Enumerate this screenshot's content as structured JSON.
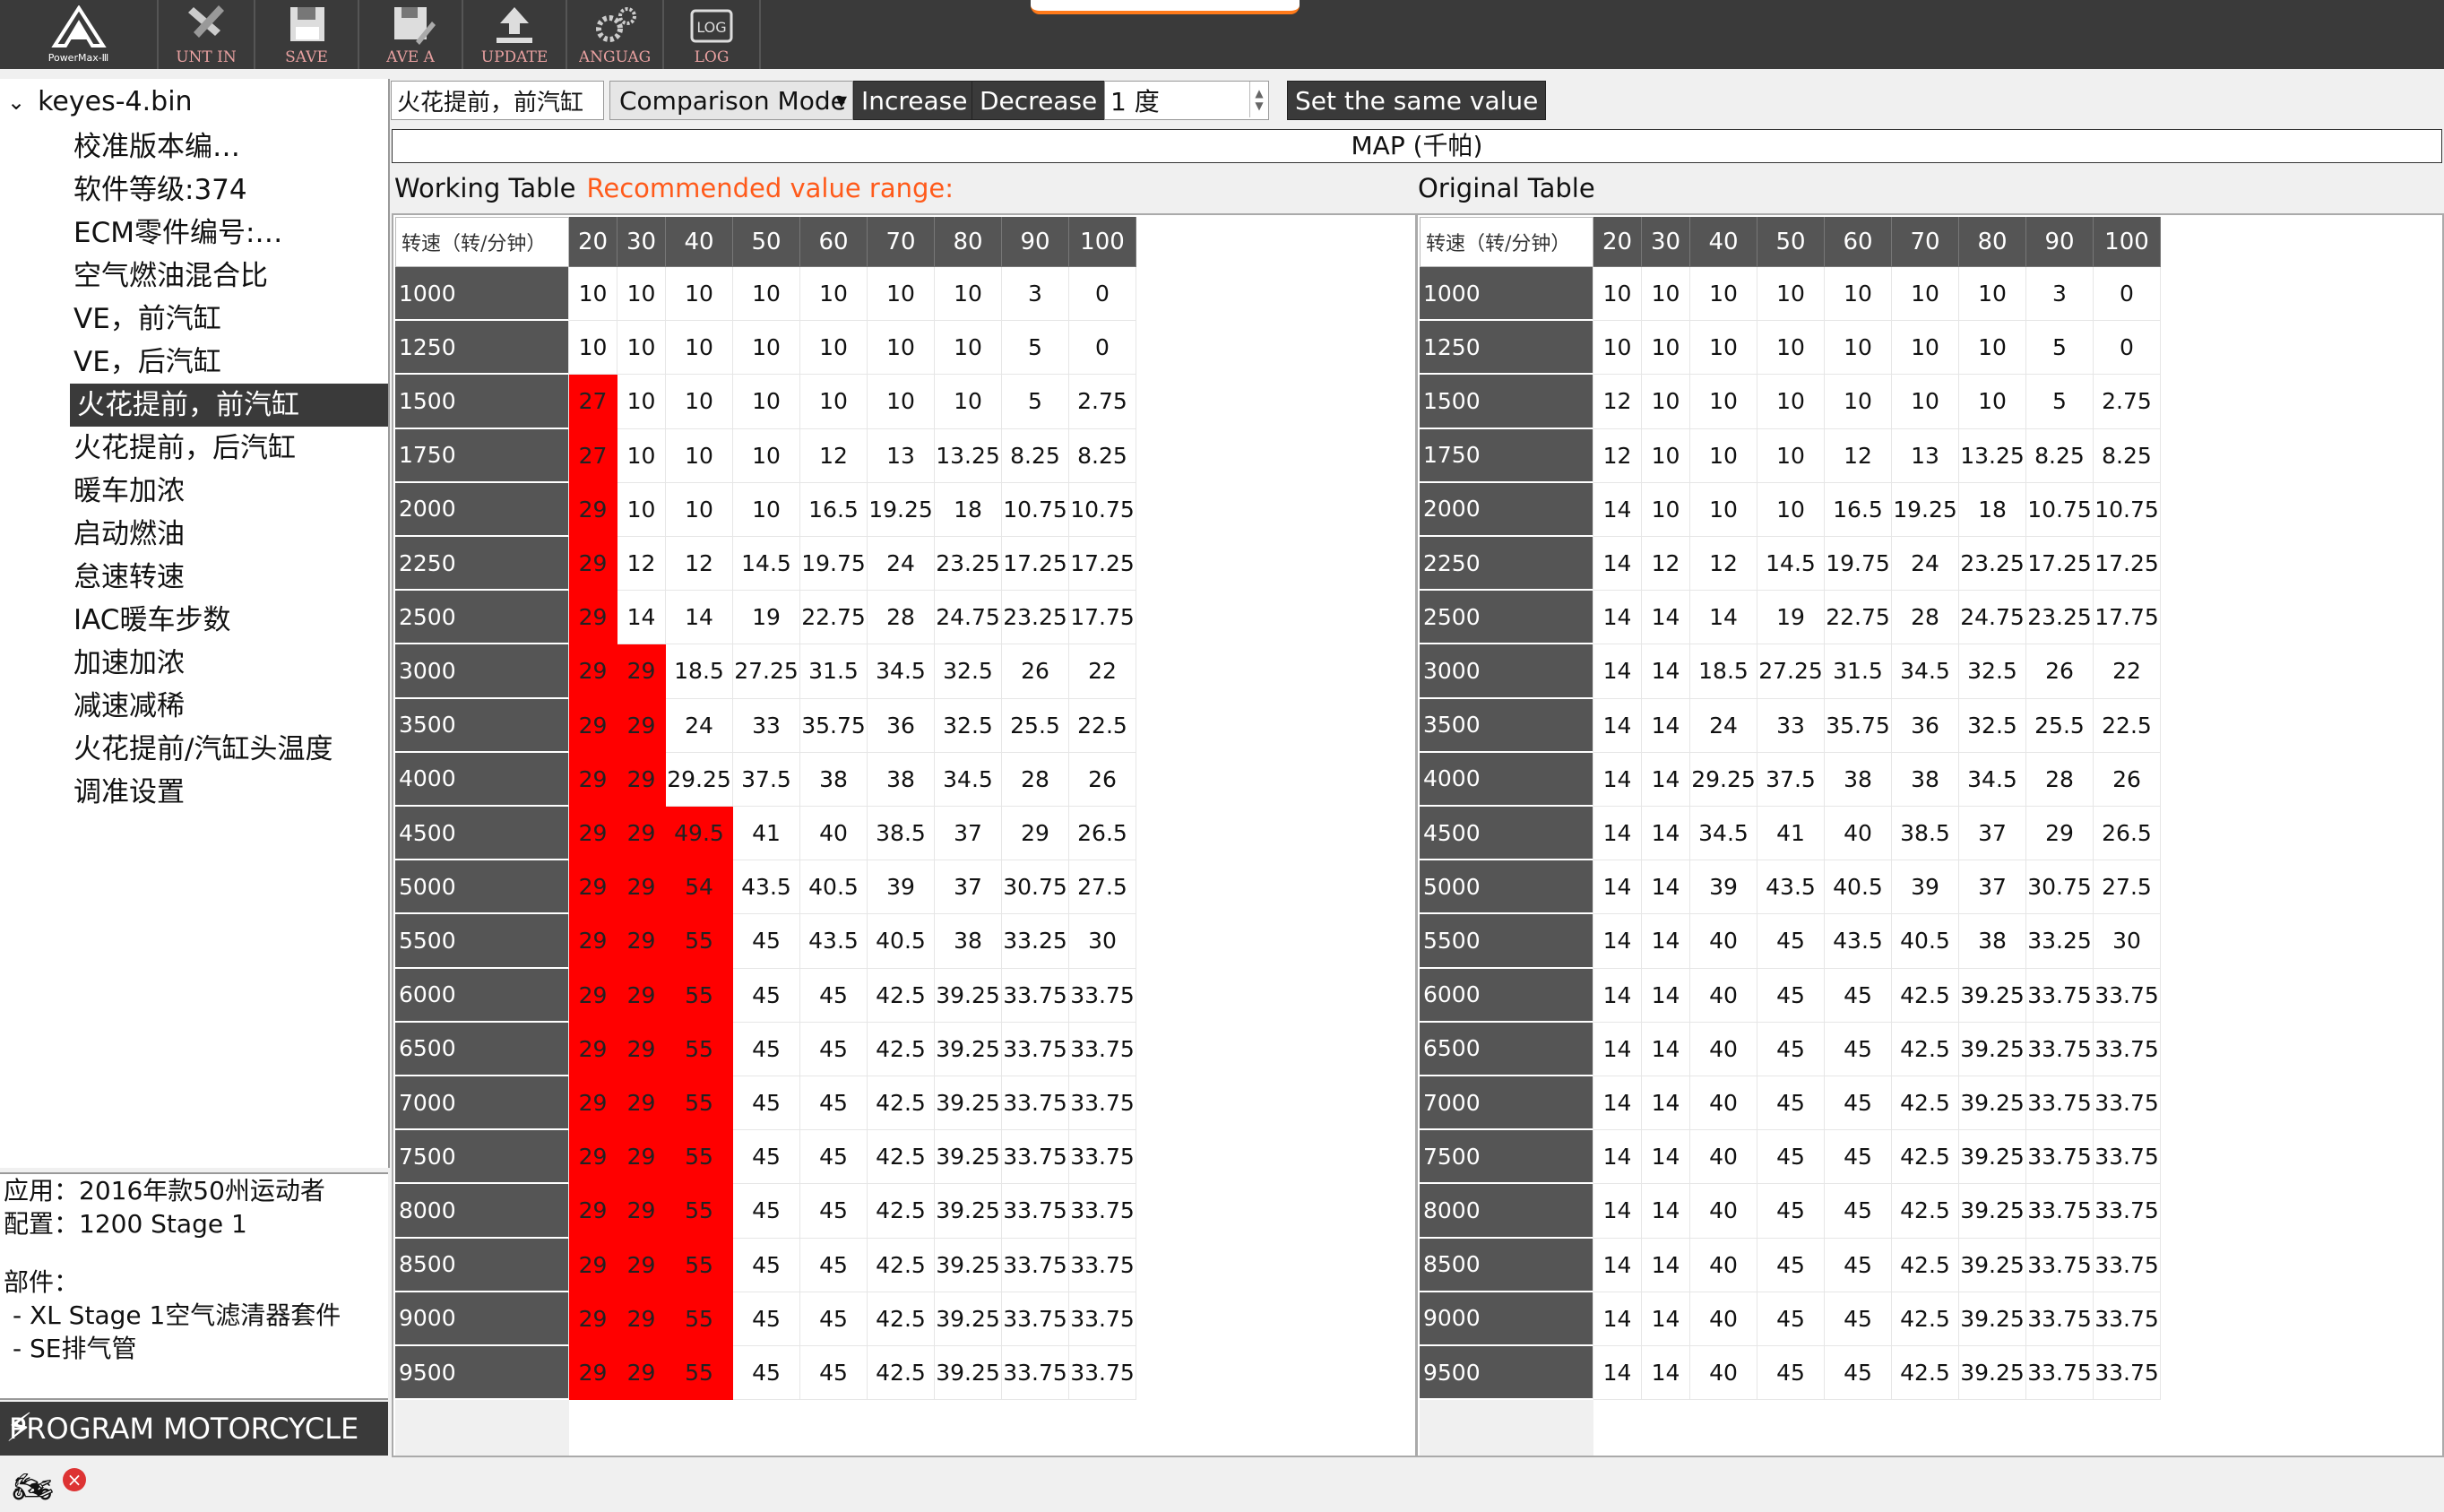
{
  "toolbar": {
    "logo_text": "PowerMax-Ⅲ",
    "buttons": [
      {
        "label": "UNT IN",
        "icon": "wrench-icon"
      },
      {
        "label": "SAVE",
        "icon": "floppy-disk-icon"
      },
      {
        "label": "AVE A",
        "icon": "save-as-icon"
      },
      {
        "label": "UPDATE",
        "icon": "upload-icon"
      },
      {
        "label": "ANGUAG",
        "icon": "gears-icon"
      },
      {
        "label": "LOG",
        "icon": "log-icon"
      }
    ]
  },
  "sidebar": {
    "file_name": "keyes-4.bin",
    "items": [
      "校准版本编…",
      "软件等级:374",
      "ECM零件编号:…",
      "空气燃油混合比",
      "VE，前汽缸",
      "VE，后汽缸",
      "火花提前，前汽缸",
      "火花提前，后汽缸",
      "暖车加浓",
      "启动燃油",
      "怠速转速",
      "IAC暖车步数",
      "加速加浓",
      "减速减稀",
      "火花提前/汽缸头温度",
      "调准设置"
    ],
    "selected_index": 6,
    "info": {
      "application": "应用：2016年款50州运动者",
      "config": "配置：1200 Stage 1",
      "parts_label": "部件：",
      "parts": [
        "- XL Stage 1空气滤清器套件",
        "- SE排气管"
      ]
    },
    "program_button": "PROGRAM MOTORCYCLE"
  },
  "controls": {
    "table_select": "火花提前，前汽缸",
    "mode": "Comparison Mode",
    "increase": "Increase",
    "decrease": "Decrease",
    "step": "1 度",
    "set_same": "Set the same value"
  },
  "map_label": "MAP (千帕)",
  "working": {
    "title": "Working Table",
    "recommended": "Recommended value range:"
  },
  "original": {
    "title": "Original Table"
  },
  "table": {
    "corner": "转速（转/分钟）",
    "columns": [
      "20",
      "30",
      "40",
      "50",
      "60",
      "70",
      "80",
      "90",
      "100"
    ],
    "rows": [
      "1000",
      "1250",
      "1500",
      "1750",
      "2000",
      "2250",
      "2500",
      "3000",
      "3500",
      "4000",
      "4500",
      "5000",
      "5500",
      "6000",
      "6500",
      "7000",
      "7500",
      "8000",
      "8500",
      "9000",
      "9500"
    ]
  },
  "working_values": [
    [
      "10",
      "10",
      "10",
      "10",
      "10",
      "10",
      "10",
      "3",
      "0"
    ],
    [
      "10",
      "10",
      "10",
      "10",
      "10",
      "10",
      "10",
      "5",
      "0"
    ],
    [
      "27",
      "10",
      "10",
      "10",
      "10",
      "10",
      "10",
      "5",
      "2.75"
    ],
    [
      "27",
      "10",
      "10",
      "10",
      "12",
      "13",
      "13.25",
      "8.25",
      "8.25"
    ],
    [
      "29",
      "10",
      "10",
      "10",
      "16.5",
      "19.25",
      "18",
      "10.75",
      "10.75"
    ],
    [
      "29",
      "12",
      "12",
      "14.5",
      "19.75",
      "24",
      "23.25",
      "17.25",
      "17.25"
    ],
    [
      "29",
      "14",
      "14",
      "19",
      "22.75",
      "28",
      "24.75",
      "23.25",
      "17.75"
    ],
    [
      "29",
      "29",
      "18.5",
      "27.25",
      "31.5",
      "34.5",
      "32.5",
      "26",
      "22"
    ],
    [
      "29",
      "29",
      "24",
      "33",
      "35.75",
      "36",
      "32.5",
      "25.5",
      "22.5"
    ],
    [
      "29",
      "29",
      "29.25",
      "37.5",
      "38",
      "38",
      "34.5",
      "28",
      "26"
    ],
    [
      "29",
      "29",
      "49.5",
      "41",
      "40",
      "38.5",
      "37",
      "29",
      "26.5"
    ],
    [
      "29",
      "29",
      "54",
      "43.5",
      "40.5",
      "39",
      "37",
      "30.75",
      "27.5"
    ],
    [
      "29",
      "29",
      "55",
      "45",
      "43.5",
      "40.5",
      "38",
      "33.25",
      "30"
    ],
    [
      "29",
      "29",
      "55",
      "45",
      "45",
      "42.5",
      "39.25",
      "33.75",
      "33.75"
    ],
    [
      "29",
      "29",
      "55",
      "45",
      "45",
      "42.5",
      "39.25",
      "33.75",
      "33.75"
    ],
    [
      "29",
      "29",
      "55",
      "45",
      "45",
      "42.5",
      "39.25",
      "33.75",
      "33.75"
    ],
    [
      "29",
      "29",
      "55",
      "45",
      "45",
      "42.5",
      "39.25",
      "33.75",
      "33.75"
    ],
    [
      "29",
      "29",
      "55",
      "45",
      "45",
      "42.5",
      "39.25",
      "33.75",
      "33.75"
    ],
    [
      "29",
      "29",
      "55",
      "45",
      "45",
      "42.5",
      "39.25",
      "33.75",
      "33.75"
    ],
    [
      "29",
      "29",
      "55",
      "45",
      "45",
      "42.5",
      "39.25",
      "33.75",
      "33.75"
    ],
    [
      "29",
      "29",
      "55",
      "45",
      "45",
      "42.5",
      "39.25",
      "33.75",
      "33.75"
    ]
  ],
  "original_values": [
    [
      "10",
      "10",
      "10",
      "10",
      "10",
      "10",
      "10",
      "3",
      "0"
    ],
    [
      "10",
      "10",
      "10",
      "10",
      "10",
      "10",
      "10",
      "5",
      "0"
    ],
    [
      "12",
      "10",
      "10",
      "10",
      "10",
      "10",
      "10",
      "5",
      "2.75"
    ],
    [
      "12",
      "10",
      "10",
      "10",
      "12",
      "13",
      "13.25",
      "8.25",
      "8.25"
    ],
    [
      "14",
      "10",
      "10",
      "10",
      "16.5",
      "19.25",
      "18",
      "10.75",
      "10.75"
    ],
    [
      "14",
      "12",
      "12",
      "14.5",
      "19.75",
      "24",
      "23.25",
      "17.25",
      "17.25"
    ],
    [
      "14",
      "14",
      "14",
      "19",
      "22.75",
      "28",
      "24.75",
      "23.25",
      "17.75"
    ],
    [
      "14",
      "14",
      "18.5",
      "27.25",
      "31.5",
      "34.5",
      "32.5",
      "26",
      "22"
    ],
    [
      "14",
      "14",
      "24",
      "33",
      "35.75",
      "36",
      "32.5",
      "25.5",
      "22.5"
    ],
    [
      "14",
      "14",
      "29.25",
      "37.5",
      "38",
      "38",
      "34.5",
      "28",
      "26"
    ],
    [
      "14",
      "14",
      "34.5",
      "41",
      "40",
      "38.5",
      "37",
      "29",
      "26.5"
    ],
    [
      "14",
      "14",
      "39",
      "43.5",
      "40.5",
      "39",
      "37",
      "30.75",
      "27.5"
    ],
    [
      "14",
      "14",
      "40",
      "45",
      "43.5",
      "40.5",
      "38",
      "33.25",
      "30"
    ],
    [
      "14",
      "14",
      "40",
      "45",
      "45",
      "42.5",
      "39.25",
      "33.75",
      "33.75"
    ],
    [
      "14",
      "14",
      "40",
      "45",
      "45",
      "42.5",
      "39.25",
      "33.75",
      "33.75"
    ],
    [
      "14",
      "14",
      "40",
      "45",
      "45",
      "42.5",
      "39.25",
      "33.75",
      "33.75"
    ],
    [
      "14",
      "14",
      "40",
      "45",
      "45",
      "42.5",
      "39.25",
      "33.75",
      "33.75"
    ],
    [
      "14",
      "14",
      "40",
      "45",
      "45",
      "42.5",
      "39.25",
      "33.75",
      "33.75"
    ],
    [
      "14",
      "14",
      "40",
      "45",
      "45",
      "42.5",
      "39.25",
      "33.75",
      "33.75"
    ],
    [
      "14",
      "14",
      "40",
      "45",
      "45",
      "42.5",
      "39.25",
      "33.75",
      "33.75"
    ],
    [
      "14",
      "14",
      "40",
      "45",
      "45",
      "42.5",
      "39.25",
      "33.75",
      "33.75"
    ]
  ],
  "colors": {
    "highlight": "#ff0000",
    "header": "#555555",
    "recommended_text": "#ff5a1a"
  }
}
